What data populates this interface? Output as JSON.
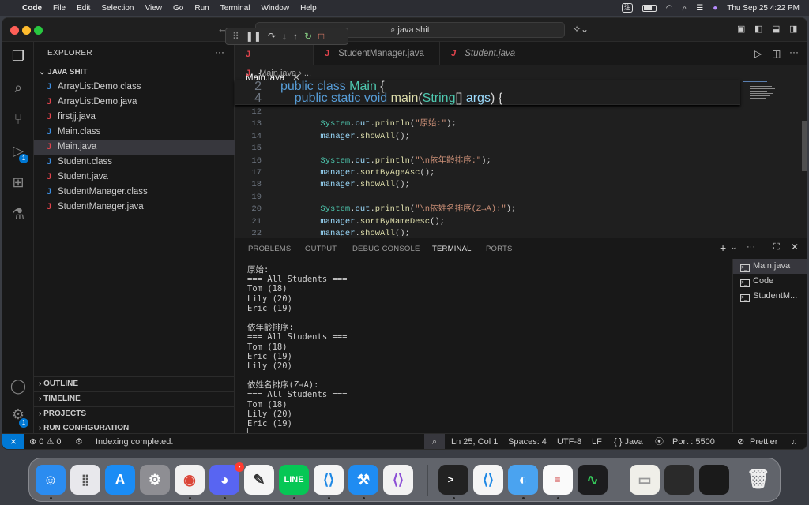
{
  "menubar": {
    "app": "Code",
    "items": [
      "File",
      "Edit",
      "Selection",
      "View",
      "Go",
      "Run",
      "Terminal",
      "Window",
      "Help"
    ],
    "ime": "注",
    "clock": "Thu Sep 25  4:22 PM"
  },
  "titlebar": {
    "search": "java shit"
  },
  "explorer": {
    "title": "EXPLORER",
    "root": "JAVA SHIT",
    "files": [
      {
        "name": "ArrayListDemo.class",
        "icon": "blue"
      },
      {
        "name": "ArrayListDemo.java",
        "icon": "red"
      },
      {
        "name": "firstjj.java",
        "icon": "red"
      },
      {
        "name": "Main.class",
        "icon": "blue"
      },
      {
        "name": "Main.java",
        "icon": "red"
      },
      {
        "name": "Student.class",
        "icon": "blue"
      },
      {
        "name": "Student.java",
        "icon": "red"
      },
      {
        "name": "StudentManager.class",
        "icon": "blue"
      },
      {
        "name": "StudentManager.java",
        "icon": "red"
      }
    ],
    "selected": "Main.java",
    "sections": [
      "OUTLINE",
      "TIMELINE",
      "PROJECTS",
      "RUN CONFIGURATION"
    ]
  },
  "activity_badges": {
    "run": "1",
    "settings": "1"
  },
  "editor": {
    "tabs": [
      {
        "label": "Main.java",
        "active": true
      },
      {
        "label": "StudentManager.java",
        "active": false
      },
      {
        "label": "Student.java",
        "active": false
      }
    ],
    "breadcrumb": "Main.java  › ...",
    "sticky": [
      {
        "ln": "2",
        "html": "<span class=\"kw\">public</span> <span class=\"kw\">class</span> <span class=\"cls\">Main</span> {"
      },
      {
        "ln": "4",
        "html": "    <span class=\"kw\">public</span> <span class=\"kw\">static</span> <span class=\"kw\">void</span> <span class=\"fn\">main</span>(<span class=\"ty\">String</span>[] <span class=\"var\">args</span>) {"
      }
    ],
    "lines": [
      {
        "ln": "12",
        "html": ""
      },
      {
        "ln": "13",
        "html": "        <span class=\"cls\">System</span>.<span class=\"var\">out</span>.<span class=\"fn\">println</span>(<span class=\"str\">\"原始:\"</span>);"
      },
      {
        "ln": "14",
        "html": "        <span class=\"var\">manager</span>.<span class=\"fn\">showAll</span>();"
      },
      {
        "ln": "15",
        "html": ""
      },
      {
        "ln": "16",
        "html": "        <span class=\"cls\">System</span>.<span class=\"var\">out</span>.<span class=\"fn\">println</span>(<span class=\"str\">\"\\n依年齡排序:\"</span>);"
      },
      {
        "ln": "17",
        "html": "        <span class=\"var\">manager</span>.<span class=\"fn\">sortByAgeAsc</span>();"
      },
      {
        "ln": "18",
        "html": "        <span class=\"var\">manager</span>.<span class=\"fn\">showAll</span>();"
      },
      {
        "ln": "19",
        "html": ""
      },
      {
        "ln": "20",
        "html": "        <span class=\"cls\">System</span>.<span class=\"var\">out</span>.<span class=\"fn\">println</span>(<span class=\"str\">\"\\n依姓名排序(Z→A):\"</span>);"
      },
      {
        "ln": "21",
        "html": "        <span class=\"var\">manager</span>.<span class=\"fn\">sortByNameDesc</span>();"
      },
      {
        "ln": "22",
        "html": "        <span class=\"var\">manager</span>.<span class=\"fn\">showAll</span>();"
      }
    ]
  },
  "panel": {
    "tabs": [
      "PROBLEMS",
      "OUTPUT",
      "DEBUG CONSOLE",
      "TERMINAL",
      "PORTS"
    ],
    "active_tab": "TERMINAL",
    "terminal_lines": [
      "原始:",
      "=== All Students ===",
      "Tom (18)",
      "Lily (20)",
      "Eric (19)",
      "",
      "依年齡排序:",
      "=== All Students ===",
      "Tom (18)",
      "Eric (19)",
      "Lily (20)",
      "",
      "依姓名排序(Z→A):",
      "=== All Students ===",
      "Tom (18)",
      "Lily (20)",
      "Eric (19)",
      "▏"
    ],
    "terminals": [
      "Main.java",
      "Code",
      "StudentM..."
    ]
  },
  "status": {
    "problems": "⊗ 0 ⚠ 0",
    "message": "Indexing completed.",
    "position": "Ln 25, Col 1",
    "spaces": "Spaces: 4",
    "encoding": "UTF-8",
    "eol": "LF",
    "language": "{ } Java",
    "port": "Port : 5500",
    "prettier": "Prettier"
  },
  "dock": {
    "apps": [
      "finder",
      "launchpad",
      "app-store",
      "system-settings",
      "chrome",
      "discord",
      "freeform",
      "line",
      "vscode",
      "xcode",
      "visual-studio",
      "terminal",
      "vscode-2",
      "preview",
      "textedit",
      "stocks",
      "file",
      "screenshot-chrome",
      "screenshot-vscode",
      "trash"
    ],
    "discord_badge": "•"
  }
}
